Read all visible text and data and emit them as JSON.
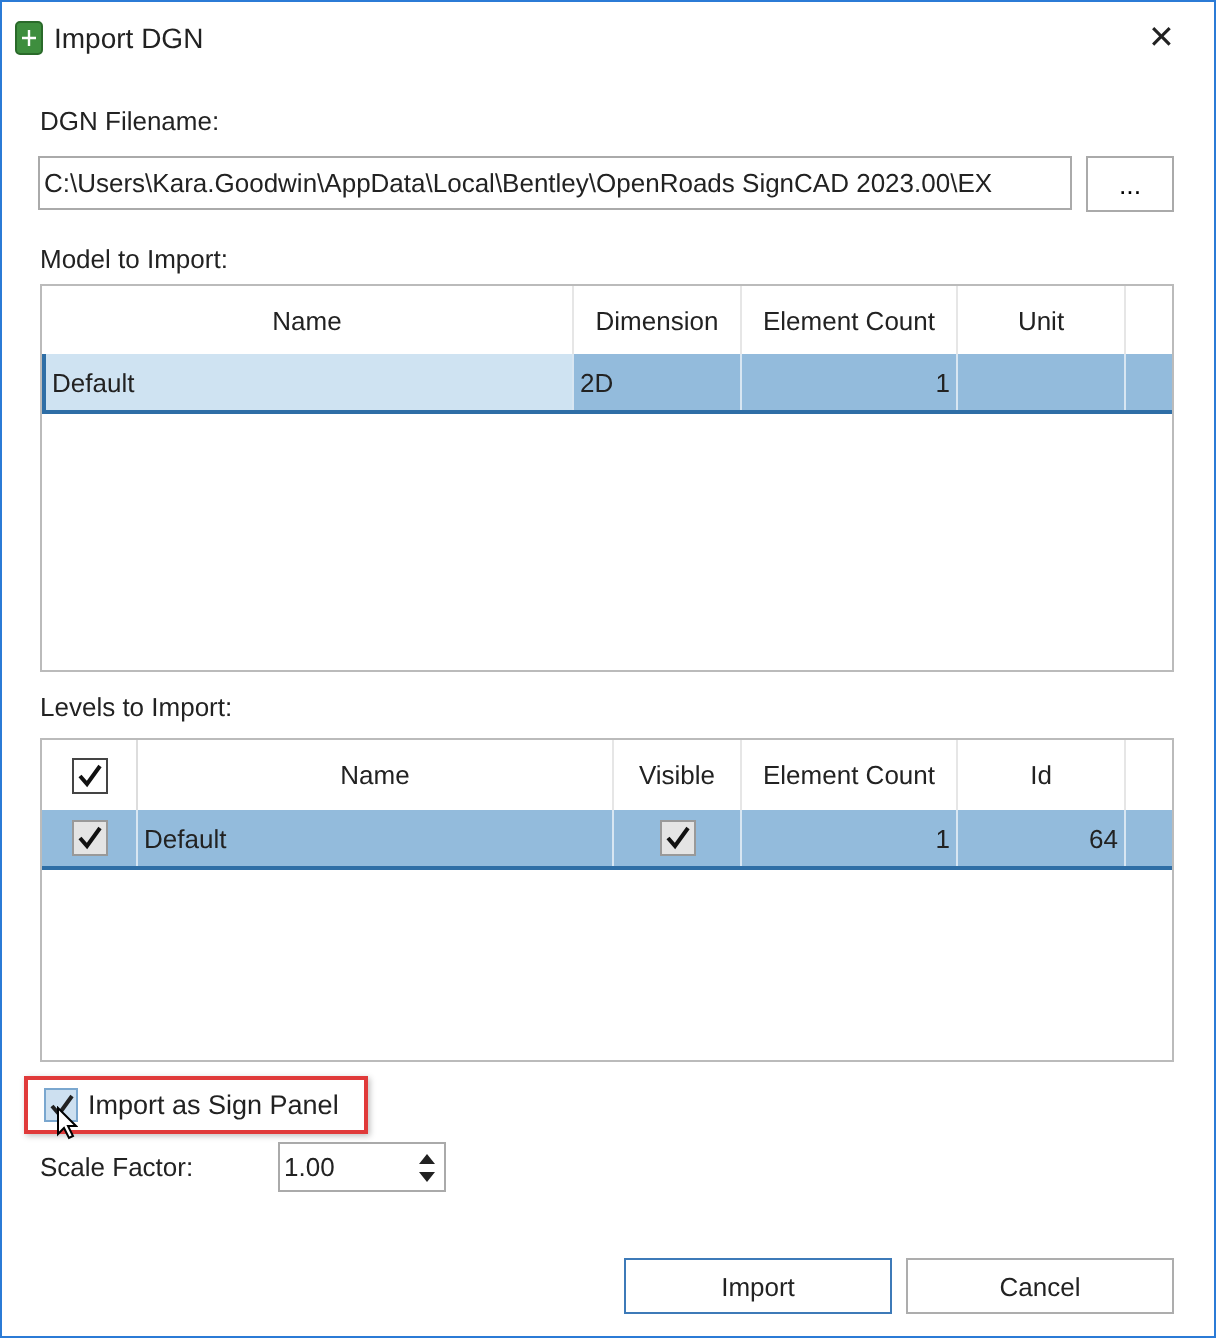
{
  "window": {
    "title": "Import DGN",
    "close": "✕"
  },
  "filename": {
    "label": "DGN Filename:",
    "value": "C:\\Users\\Kara.Goodwin\\AppData\\Local\\Bentley\\OpenRoads SignCAD 2023.00\\EX",
    "browse": "..."
  },
  "models": {
    "label": "Model to Import:",
    "columns": [
      "Name",
      "Dimension",
      "Element Count",
      "Unit"
    ],
    "rows": [
      {
        "cells": [
          "Default",
          "2D",
          "1",
          ""
        ],
        "selected": true
      }
    ]
  },
  "levels": {
    "label": "Levels to Import:",
    "all_checked": true,
    "columns": [
      "Name",
      "Visible",
      "Element Count",
      "Id"
    ],
    "rows": [
      {
        "checked": true,
        "cells": [
          "Default",
          "",
          "1",
          "64"
        ],
        "visible": true,
        "selected": true
      }
    ]
  },
  "sign_panel": {
    "label": "Import as Sign Panel",
    "checked": true,
    "highlighted": true
  },
  "scale": {
    "label": "Scale Factor:",
    "value": "1.00"
  },
  "buttons": [
    "Import",
    "Cancel"
  ]
}
